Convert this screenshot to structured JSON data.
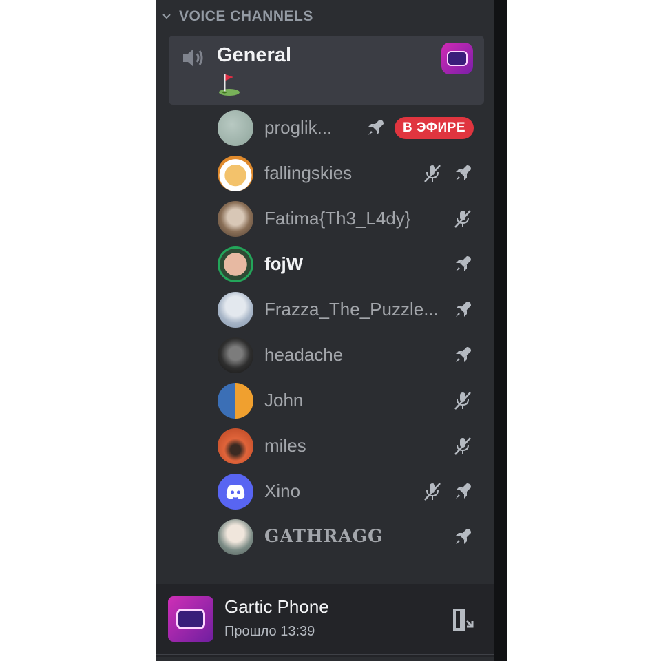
{
  "category": {
    "label": "VOICE CHANNELS"
  },
  "channel": {
    "name": "General",
    "status_emoji": "golf-flag",
    "activity_icon": "gartic-phone-icon"
  },
  "participants": [
    {
      "name": "proglik...",
      "live_label": "В ЭФИРЕ",
      "icons": [
        "rocket-icon"
      ]
    },
    {
      "name": "fallingskies",
      "icons": [
        "mic-muted-icon",
        "rocket-icon"
      ]
    },
    {
      "name": "Fatima{Th3_L4dy}",
      "icons": [
        "mic-muted-icon"
      ]
    },
    {
      "name": "fojW",
      "icons": [
        "rocket-icon"
      ],
      "speaking": true
    },
    {
      "name": "Frazza_The_Puzzle...",
      "icons": [
        "rocket-icon"
      ]
    },
    {
      "name": "headache",
      "icons": [
        "rocket-icon"
      ]
    },
    {
      "name": "John",
      "icons": [
        "mic-muted-icon"
      ]
    },
    {
      "name": "miles",
      "icons": [
        "mic-muted-icon"
      ]
    },
    {
      "name": "Xino",
      "icons": [
        "mic-muted-icon",
        "rocket-icon"
      ]
    },
    {
      "name": "GATHRAGG",
      "icons": [
        "rocket-icon"
      ]
    }
  ],
  "activity": {
    "title": "Gartic Phone",
    "elapsed": "Прошло 13:39",
    "leave_icon": "leave-activity-icon"
  },
  "colors": {
    "panel": "#2b2d31",
    "channel_bg": "#3b3d44",
    "live_red": "#e0353f",
    "speaking_green": "#23a55a",
    "discord_blurple": "#5865f2"
  }
}
